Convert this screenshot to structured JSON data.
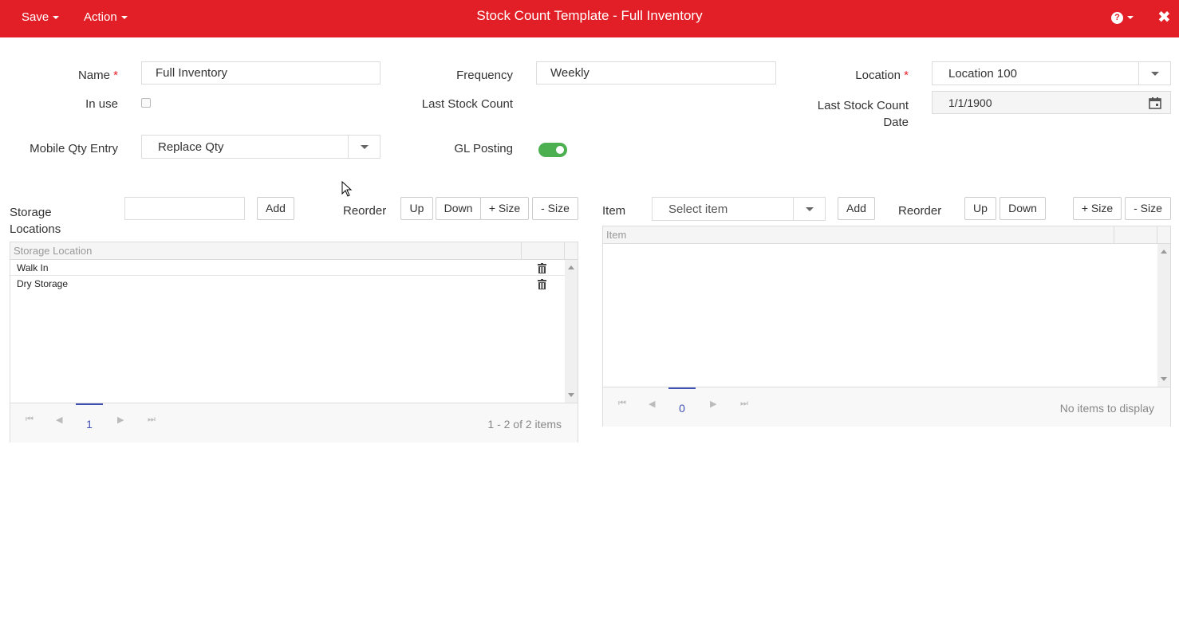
{
  "header": {
    "save_label": "Save",
    "action_label": "Action",
    "title": "Stock Count Template - Full Inventory",
    "help_glyph": "?",
    "close_glyph": "✖"
  },
  "form": {
    "name_label": "Name",
    "name_value": "Full Inventory",
    "required_mark": "*",
    "frequency_label": "Frequency",
    "frequency_value": "Weekly",
    "location_label": "Location",
    "location_value": "Location 100",
    "in_use_label": "In use",
    "in_use_checked": false,
    "last_stock_count_label": "Last Stock Count",
    "last_stock_count_date_label_1": "Last Stock Count",
    "last_stock_count_date_label_2": "Date",
    "last_stock_count_date_value": "1/1/1900",
    "mobile_qty_label": "Mobile Qty Entry",
    "mobile_qty_value": "Replace Qty",
    "gl_posting_label": "GL Posting",
    "gl_posting_on": true
  },
  "storage": {
    "label_1": "Storage",
    "label_2": "Locations",
    "add_label": "Add",
    "reorder_label": "Reorder",
    "up_label": "Up",
    "down_label": "Down",
    "plus_size_label": "+ Size",
    "minus_size_label": "- Size",
    "column_header": "Storage Location",
    "rows": [
      "Walk In",
      "Dry Storage"
    ],
    "page": "1",
    "info": "1 - 2 of 2 items"
  },
  "items": {
    "label": "Item",
    "select_placeholder": "Select item",
    "add_label": "Add",
    "reorder_label": "Reorder",
    "up_label": "Up",
    "down_label": "Down",
    "plus_size_label": "+ Size",
    "minus_size_label": "- Size",
    "column_header": "Item",
    "page": "0",
    "info": "No items to display"
  },
  "colors": {
    "brand": "#e21f26",
    "toggle_on": "#4caf50",
    "pager_accent": "#3f51b5"
  }
}
